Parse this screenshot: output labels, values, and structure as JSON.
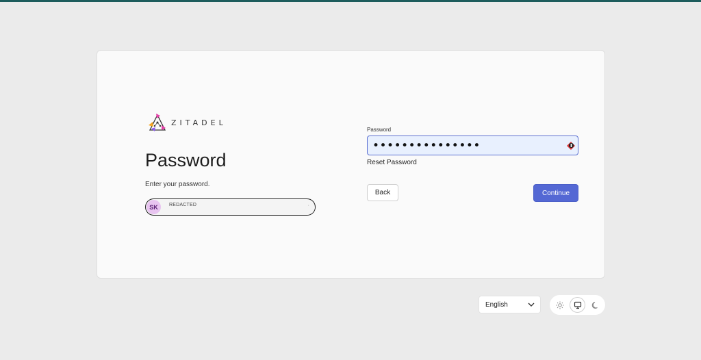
{
  "brand": {
    "logo_text": "ZITADEL"
  },
  "login": {
    "title": "Password",
    "subtitle": "Enter your password.",
    "user": {
      "initials": "SK",
      "display_name": "REDACTED",
      "avatar_color": "#e8c4f0"
    },
    "password_field": {
      "label": "Password",
      "value": "•••••••••••••••"
    },
    "reset_link": "Reset Password",
    "back_button": "Back",
    "continue_button": "Continue",
    "accent_color": "#5468d4"
  },
  "footer": {
    "language": {
      "selected": "English"
    },
    "theme": {
      "options": [
        "light-icon",
        "system-icon",
        "dark-icon"
      ],
      "active": "system-icon"
    }
  }
}
